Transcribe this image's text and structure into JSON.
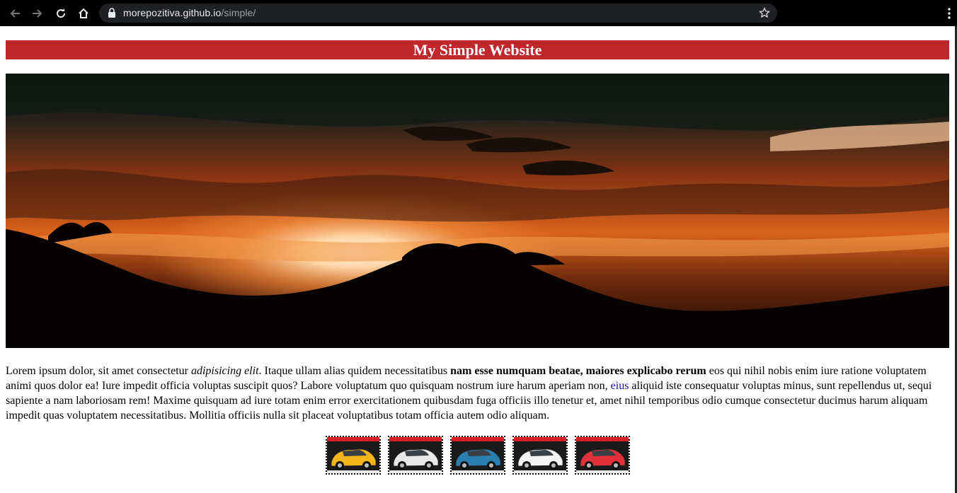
{
  "browser": {
    "url_host": "morepozitiva.github.io",
    "url_path": "/simple/",
    "icons": [
      "back-icon",
      "forward-icon",
      "reload-icon",
      "home-icon",
      "lock-icon",
      "star-icon",
      "menu-icon"
    ]
  },
  "site": {
    "title": "My Simple Website",
    "accent_color": "#c0272d"
  },
  "intro": {
    "part1": "Lorem ipsum dolor, sit amet consectetur ",
    "italic": "adipisicing elit",
    "part2": ". Itaque ullam alias quidem necessitatibus ",
    "bold": "nam esse numquam beatae, maiores explicabo rerum",
    "part3": " eos qui nihil nobis enim iure ratione voluptatem animi quos dolor ea! Iure impedit officia voluptas suscipit quos? Labore voluptatum quo quisquam nostrum iure harum aperiam non, ",
    "link": "eius",
    "part4": " aliquid iste consequatur voluptas minus, sunt repellendus ut, sequi sapiente a nam laboriosam rem! Maxime quisquam ad iure totam enim error exercitationem quibusdam fuga officiis illo tenetur et, amet nihil temporibus odio cumque consectetur ducimus harum aliquam impedit quas voluptatem necessitatibus. Mollitia officiis nulla sit placeat voluptatibus totam officia autem odio aliquam."
  },
  "gallery": {
    "cars": [
      {
        "name": "yellow-car",
        "body": "#f2b51b"
      },
      {
        "name": "white-car",
        "body": "#e9e9e9"
      },
      {
        "name": "blue-car",
        "body": "#2a7fb0"
      },
      {
        "name": "green-white-car",
        "body": "#f4f4f4"
      },
      {
        "name": "red-car",
        "body": "#e0303a"
      }
    ]
  }
}
